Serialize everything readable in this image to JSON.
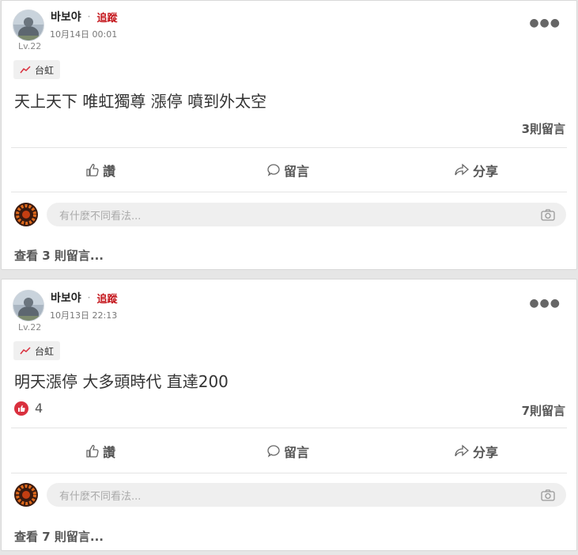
{
  "posts": [
    {
      "author": "바보야",
      "separator": "·",
      "follow_label": "追蹤",
      "timestamp": "10月14日 00:01",
      "level": "Lv.22",
      "tag": "台虹",
      "content": "天上天下 唯虹獨尊 漲停 噴到外太空",
      "likes": "",
      "comments_count": "3則留言",
      "actions": {
        "like": "讚",
        "comment": "留言",
        "share": "分享"
      },
      "comment_placeholder": "有什麼不同看法...",
      "view_all": "查看 3 則留言..."
    },
    {
      "author": "바보야",
      "separator": "·",
      "follow_label": "追蹤",
      "timestamp": "10月13日 22:13",
      "level": "Lv.22",
      "tag": "台虹",
      "content": "明天漲停 大多頭時代 直達200",
      "likes": "4",
      "comments_count": "7則留言",
      "actions": {
        "like": "讚",
        "comment": "留言",
        "share": "分享"
      },
      "comment_placeholder": "有什麼不同看法...",
      "view_all": "查看 7 則留言..."
    }
  ],
  "colors": {
    "follow": "#c4161c",
    "like_badge": "#d9303e",
    "divider": "#e4e4e4"
  }
}
